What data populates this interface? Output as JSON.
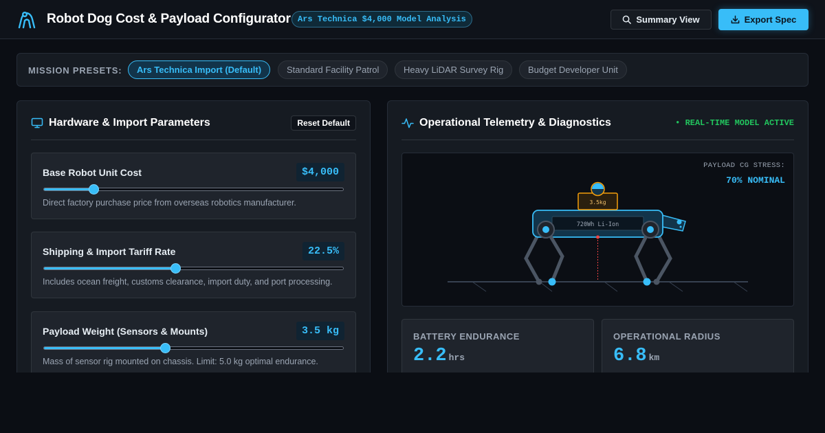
{
  "header": {
    "title": "Robot Dog Cost & Payload Configurator",
    "badge": "Ars Technica $4,000 Model Analysis",
    "summary_button": "Summary View",
    "export_button": "Export Spec"
  },
  "presets": {
    "label": "MISSION PRESETS:",
    "items": [
      {
        "label": "Ars Technica Import (Default)",
        "active": true
      },
      {
        "label": "Standard Facility Patrol",
        "active": false
      },
      {
        "label": "Heavy LiDAR Survey Rig",
        "active": false
      },
      {
        "label": "Budget Developer Unit",
        "active": false
      }
    ]
  },
  "hardware": {
    "title": "Hardware & Import Parameters",
    "reset_label": "Reset Default",
    "params": [
      {
        "label": "Base Robot Unit Cost",
        "value": "$4,000",
        "level": 0.165,
        "desc": "Direct factory purchase price from overseas robotics manufacturer."
      },
      {
        "label": "Shipping & Import Tariff Rate",
        "value": "22.5%",
        "level": 0.44,
        "desc": "Includes ocean freight, customs clearance, import duty, and port processing."
      },
      {
        "label": "Payload Weight (Sensors & Mounts)",
        "value": "3.5 kg",
        "level": 0.404,
        "desc": "Mass of sensor rig mounted on chassis. Limit: 5.0 kg optimal endurance."
      }
    ]
  },
  "telemetry": {
    "title": "Operational Telemetry & Diagnostics",
    "status": "• REAL-TIME MODEL ACTIVE",
    "stress_label": "PAYLOAD CG STRESS:",
    "stress_value": "70% NOMINAL",
    "payload_tag": "3.5kg",
    "battery_tag": "720Wh Li-Ion",
    "metrics": [
      {
        "label": "BATTERY ENDURANCE",
        "value": "2.2",
        "unit": "hrs"
      },
      {
        "label": "OPERATIONAL RADIUS",
        "value": "6.8",
        "unit": "km"
      }
    ]
  },
  "colors": {
    "accent": "#38bdf8",
    "status_green": "#22c55e",
    "payload_orange": "#f59e0b",
    "cg_red": "#ef4444"
  },
  "icons": {
    "logo": "robot-dog-logo-icon",
    "summary": "search-icon",
    "export": "download-icon",
    "hardware": "monitor-icon",
    "telemetry": "activity-icon"
  }
}
